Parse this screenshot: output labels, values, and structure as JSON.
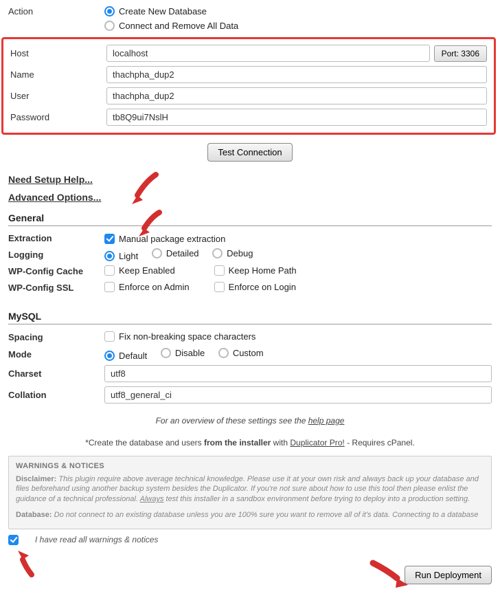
{
  "action": {
    "label": "Action",
    "option_create": "Create New Database",
    "option_remove": "Connect and Remove All Data",
    "selected": "create"
  },
  "host": {
    "label": "Host",
    "value": "localhost",
    "port_label": "Port: 3306"
  },
  "name": {
    "label": "Name",
    "value": "thachpha_dup2"
  },
  "user": {
    "label": "User",
    "value": "thachpha_dup2"
  },
  "password": {
    "label": "Password",
    "value": "tb8Q9ui7NslH"
  },
  "test_button": "Test Connection",
  "links": {
    "setup_help": "Need Setup Help...",
    "advanced": "Advanced Options..."
  },
  "general": {
    "header": "General",
    "extraction": {
      "label": "Extraction",
      "option": "Manual package extraction",
      "checked": true
    },
    "logging": {
      "label": "Logging",
      "opts": [
        "Light",
        "Detailed",
        "Debug"
      ],
      "selected": 0
    },
    "wpcache": {
      "label": "WP-Config Cache",
      "opts": [
        "Keep Enabled",
        "Keep Home Path"
      ]
    },
    "wpssl": {
      "label": "WP-Config SSL",
      "opts": [
        "Enforce on Admin",
        "Enforce on Login"
      ]
    }
  },
  "mysql": {
    "header": "MySQL",
    "spacing": {
      "label": "Spacing",
      "option": "Fix non-breaking space characters"
    },
    "mode": {
      "label": "Mode",
      "opts": [
        "Default",
        "Disable",
        "Custom"
      ],
      "selected": 0
    },
    "charset": {
      "label": "Charset",
      "value": "utf8"
    },
    "collation": {
      "label": "Collation",
      "value": "utf8_general_ci"
    }
  },
  "hints": {
    "overview_pre": "For an overview of these settings see the ",
    "overview_link": "help page",
    "pro_pre": "*Create the database and users ",
    "pro_bold": "from the installer",
    "pro_mid": " with ",
    "pro_link": "Duplicator Pro!",
    "pro_post": " - Requires cPanel."
  },
  "warnings": {
    "title": "WARNINGS & NOTICES",
    "disclaimer_label": "Disclaimer:",
    "disclaimer_text": " This plugin require above average technical knowledge. Please use it at your own risk and always back up your database and files beforehand using another backup system besides the Duplicator. If you're not sure about how to use this tool then please enlist the guidance of a technical professional. ",
    "disclaimer_always": "Always",
    "disclaimer_text2": " test this installer in a sandbox environment before trying to deploy into a production setting.",
    "database_label": "Database:",
    "database_text": " Do not connect to an existing database unless you are 100% sure you want to remove all of it's data. Connecting to a database"
  },
  "confirm": {
    "label": "I have read all warnings & notices",
    "checked": true
  },
  "run_button": "Run Deployment"
}
